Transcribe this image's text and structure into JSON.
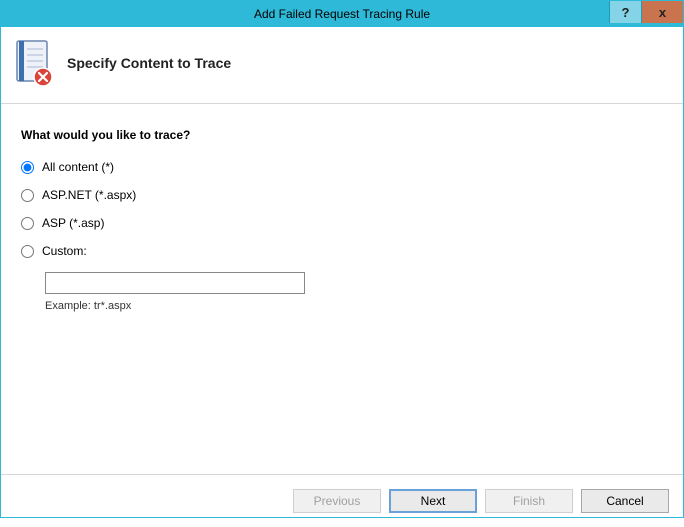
{
  "window": {
    "title": "Add Failed Request Tracing Rule"
  },
  "header": {
    "title": "Specify Content to Trace"
  },
  "content": {
    "question": "What would you like to trace?",
    "options": {
      "all": "All content (*)",
      "aspnet": "ASP.NET (*.aspx)",
      "asp": "ASP (*.asp)",
      "custom": "Custom:"
    },
    "selected": "all",
    "custom_value": "",
    "example_label": "Example: tr*.aspx"
  },
  "footer": {
    "previous": "Previous",
    "next": "Next",
    "finish": "Finish",
    "cancel": "Cancel"
  }
}
